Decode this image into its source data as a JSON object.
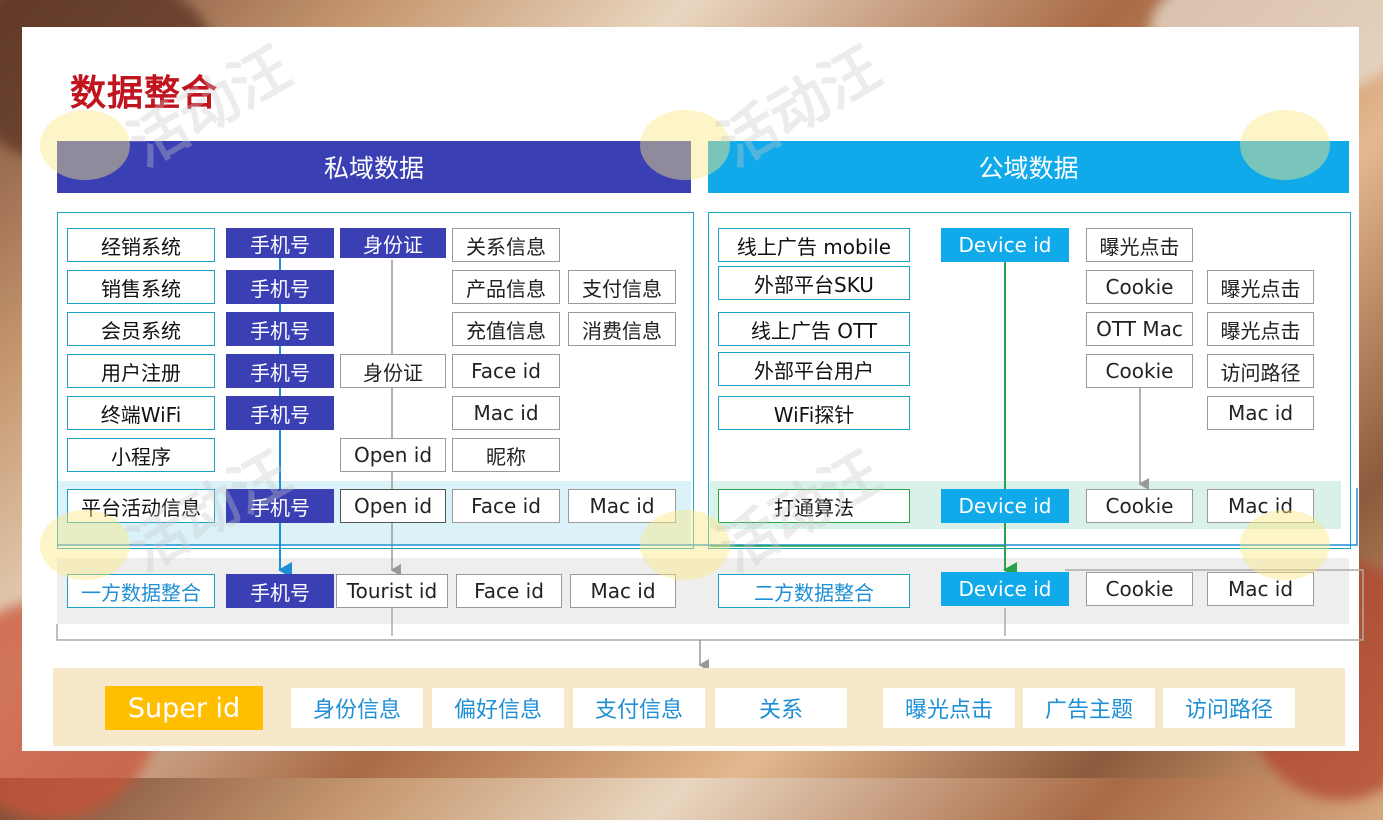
{
  "title": "数据整合",
  "watermark": "活动汪",
  "headers": {
    "private": "私域数据",
    "public": "公域数据"
  },
  "private": {
    "sources": [
      "经销系统",
      "销售系统",
      "会员系统",
      "用户注册",
      "终端WiFi",
      "小程序",
      "平台活动信息"
    ],
    "phone": "手机号",
    "id_card": "身份证",
    "open_id": "Open id",
    "face_id": "Face id",
    "mac_id": "Mac id",
    "relation_info": "关系信息",
    "product_info": "产品信息",
    "payment_info": "支付信息",
    "recharge_info": "充值信息",
    "consume_info": "消费信息",
    "nickname": "昵称"
  },
  "public": {
    "sources": [
      "线上广告 mobile",
      "外部平台SKU",
      "线上广告 OTT",
      "外部平台用户",
      "WiFi探针",
      "打通算法"
    ],
    "device_id": "Device id",
    "exposure_click": "曝光点击",
    "cookie": "Cookie",
    "ott_mac": "OTT Mac",
    "visit_path": "访问路径",
    "mac_id": "Mac id"
  },
  "integration": {
    "first_party": "一方数据整合",
    "second_party": "二方数据整合",
    "tourist_id": "Tourist id"
  },
  "super": {
    "label": "Super id",
    "tags": [
      "身份信息",
      "偏好信息",
      "支付信息",
      "关系",
      "曝光点击",
      "广告主题",
      "访问路径"
    ]
  },
  "colors": {
    "private": "#3a3fb3",
    "public": "#10aaeb",
    "title": "#c0141e",
    "super": "#ffbf00"
  }
}
